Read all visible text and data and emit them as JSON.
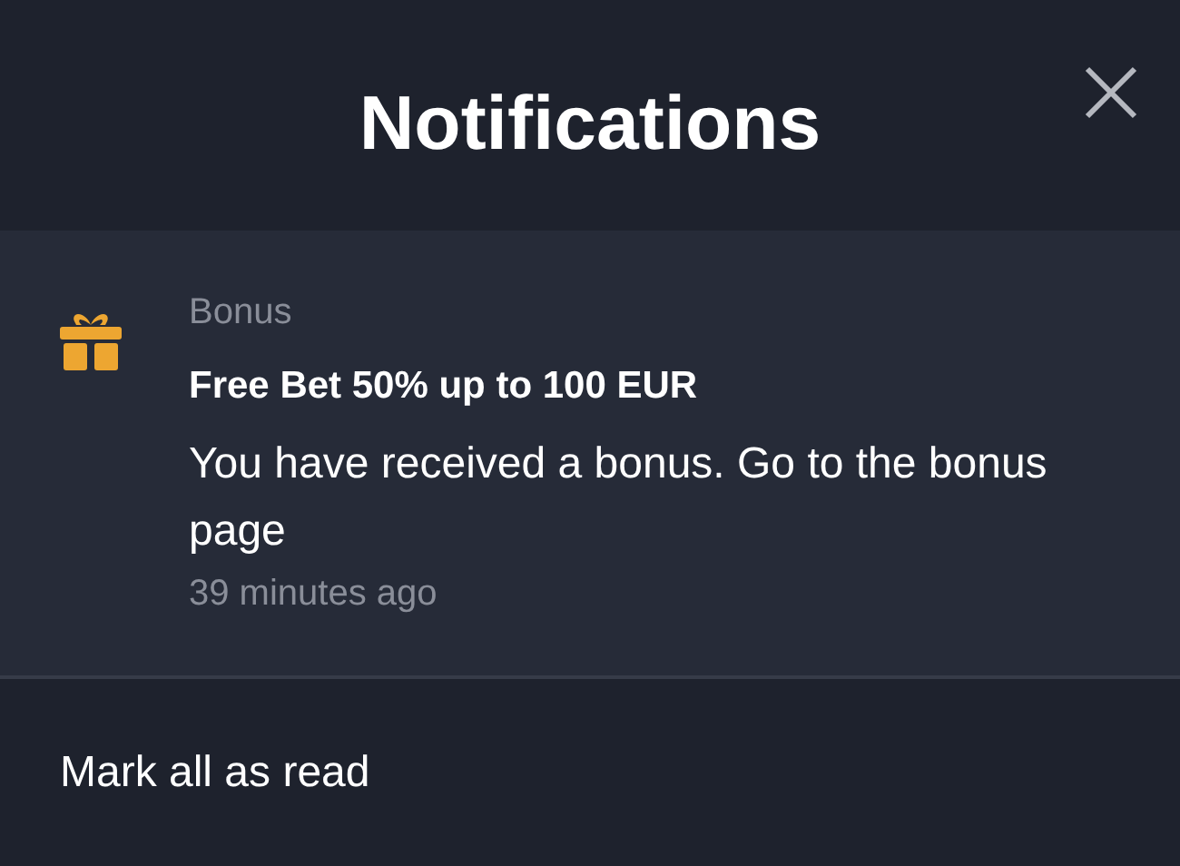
{
  "header": {
    "title": "Notifications"
  },
  "notifications": [
    {
      "kind": "gift",
      "category": "Bonus",
      "title": "Free Bet 50% up to 100 EUR",
      "message": "You have received a bonus. Go to the bonus page",
      "time": "39 minutes ago"
    }
  ],
  "footer": {
    "action": "Mark all as read"
  }
}
